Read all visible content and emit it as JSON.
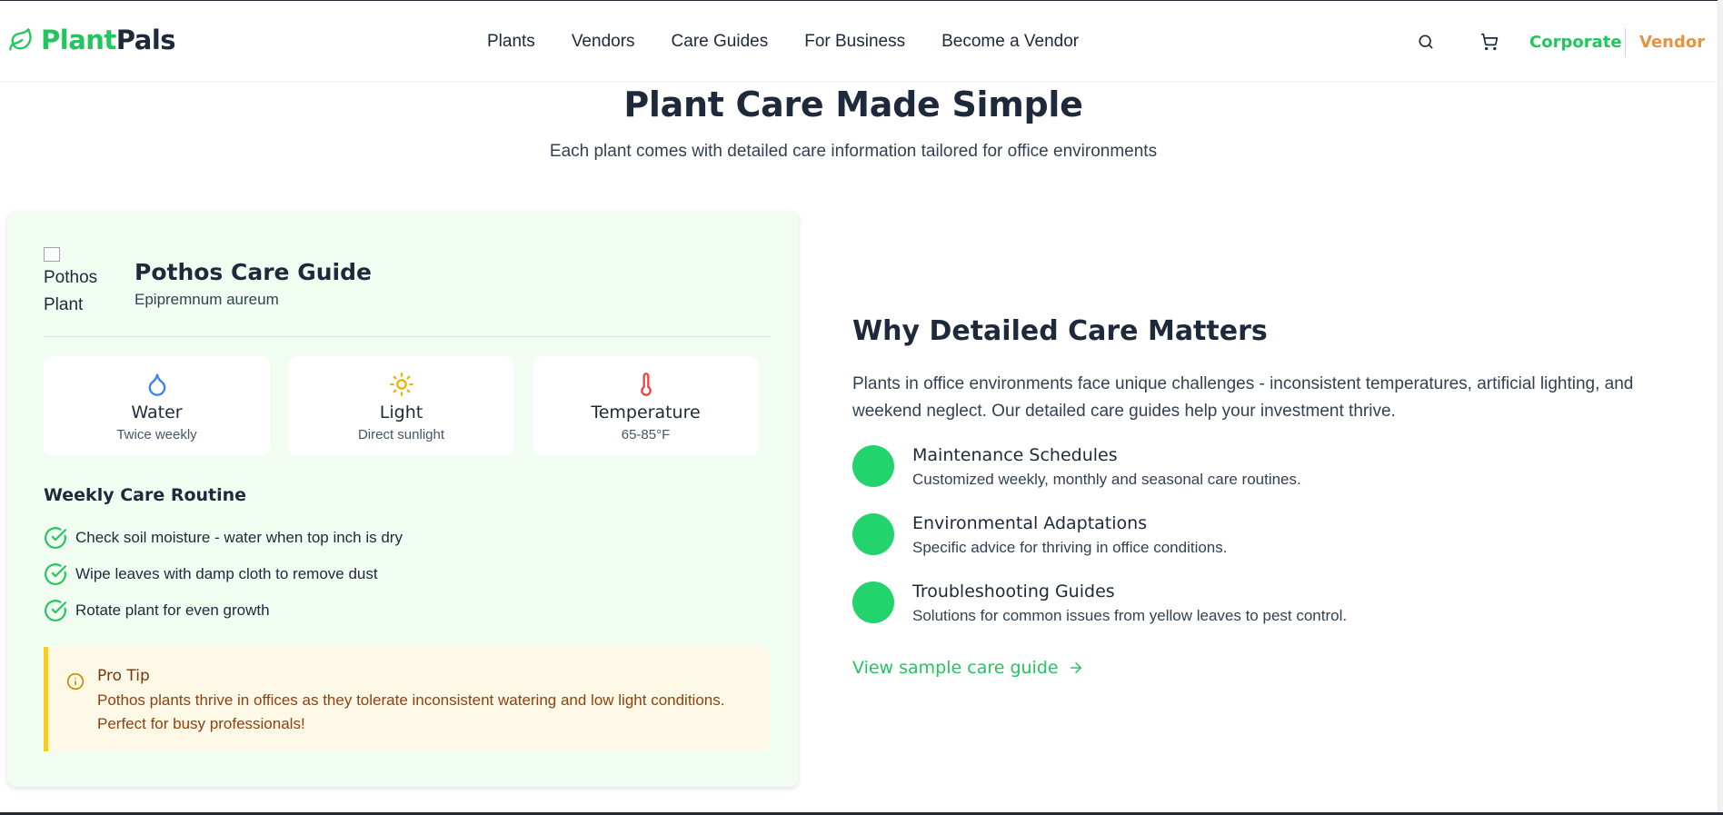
{
  "brand": {
    "part1": "Plant",
    "part2": "Pals"
  },
  "nav": [
    {
      "label": "Plants"
    },
    {
      "label": "Vendors"
    },
    {
      "label": "Care Guides"
    },
    {
      "label": "For Business"
    },
    {
      "label": "Become a Vendor"
    }
  ],
  "header_actions": {
    "corporate": "Corporate",
    "vendor": "Vendor",
    "search_icon": "search-icon",
    "cart_icon": "cart-icon"
  },
  "hero": {
    "title": "Plant Care Made Simple",
    "subtitle": "Each plant comes with detailed care information tailored for office environments"
  },
  "care_card": {
    "image_alt": "Pothos Plant",
    "title": "Pothos Care Guide",
    "scientific_name": "Epipremnum aureum",
    "stats": [
      {
        "label": "Water",
        "value": "Twice weekly",
        "icon": "water-drop-icon"
      },
      {
        "label": "Light",
        "value": "Direct sunlight",
        "icon": "sun-icon"
      },
      {
        "label": "Temperature",
        "value": "65-85°F",
        "icon": "thermometer-icon"
      }
    ],
    "routine_title": "Weekly Care Routine",
    "routine": [
      "Check soil moisture - water when top inch is dry",
      "Wipe leaves with damp cloth to remove dust",
      "Rotate plant for even growth"
    ],
    "tip": {
      "title": "Pro Tip",
      "text": "Pothos plants thrive in offices as they tolerate inconsistent watering and low light conditions. Perfect for busy professionals!"
    }
  },
  "why": {
    "title": "Why Detailed Care Matters",
    "text": "Plants in office environments face unique challenges - inconsistent temperatures, artificial lighting, and weekend neglect. Our detailed care guides help your investment thrive.",
    "features": [
      {
        "title": "Maintenance Schedules",
        "desc": "Customized weekly, monthly and seasonal care routines."
      },
      {
        "title": "Environmental Adaptations",
        "desc": "Specific advice for thriving in office conditions."
      },
      {
        "title": "Troubleshooting Guides",
        "desc": "Solutions for common issues from yellow leaves to pest control."
      }
    ],
    "link": "View sample care guide"
  },
  "colors": {
    "brand_green": "#22c55e",
    "vendor_orange": "#e8923f",
    "dot_green": "#22d46b",
    "tip_border": "#facc15"
  }
}
